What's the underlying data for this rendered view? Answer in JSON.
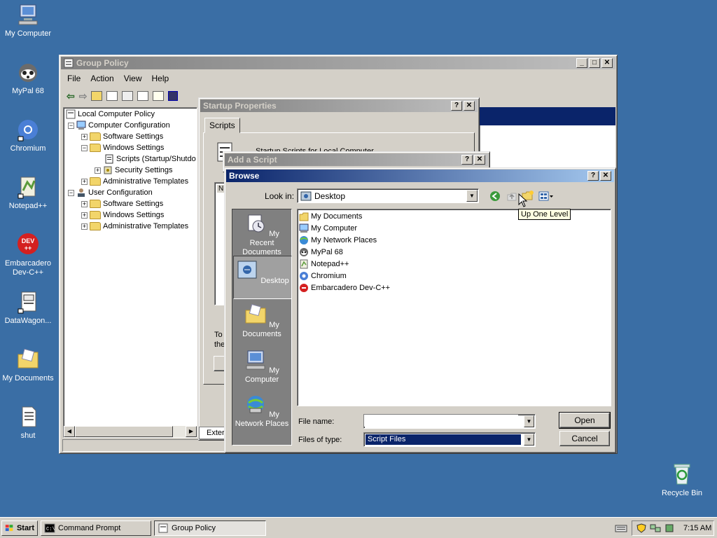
{
  "desktop": {
    "icons": [
      {
        "label": "My Computer"
      },
      {
        "label": "MyPal 68"
      },
      {
        "label": "Chromium"
      },
      {
        "label": "Notepad++"
      },
      {
        "label": "Embarcadero Dev-C++"
      },
      {
        "label": "DataWagon..."
      },
      {
        "label": "My Documents"
      },
      {
        "label": "shut"
      },
      {
        "label": "Recycle Bin"
      }
    ]
  },
  "group_policy": {
    "title": "Group Policy",
    "menu": [
      "File",
      "Action",
      "View",
      "Help"
    ],
    "tree": [
      {
        "label": "Local Computer Policy",
        "sign": ""
      },
      {
        "label": "Computer Configuration",
        "sign": "−"
      },
      {
        "label": "Software Settings",
        "sign": "+"
      },
      {
        "label": "Windows Settings",
        "sign": "−"
      },
      {
        "label": "Scripts (Startup/Shutdo",
        "sign": ""
      },
      {
        "label": "Security Settings",
        "sign": "+"
      },
      {
        "label": "Administrative Templates",
        "sign": "+"
      },
      {
        "label": "User Configuration",
        "sign": "−"
      },
      {
        "label": "Software Settings",
        "sign": "+"
      },
      {
        "label": "Windows Settings",
        "sign": "+"
      },
      {
        "label": "Administrative Templates",
        "sign": "+"
      }
    ],
    "extended_tab": "Exter"
  },
  "startup_properties": {
    "title": "Startup Properties",
    "tab": "Scripts",
    "heading": "Startup Scripts for Local Computer",
    "col_header": "N",
    "hint1": "To",
    "hint2": "the"
  },
  "add_script": {
    "title": "Add a Script"
  },
  "browse": {
    "title": "Browse",
    "look_in_label": "Look in:",
    "look_in_value": "Desktop",
    "tooltip": "Up One Level",
    "places": [
      {
        "label": "My Recent Documents"
      },
      {
        "label": "Desktop"
      },
      {
        "label": "My Documents"
      },
      {
        "label": "My Computer"
      },
      {
        "label": "My Network Places"
      }
    ],
    "files": [
      {
        "label": "My Documents"
      },
      {
        "label": "My Computer"
      },
      {
        "label": "My Network Places"
      },
      {
        "label": "MyPal 68"
      },
      {
        "label": "Notepad++"
      },
      {
        "label": "Chromium"
      },
      {
        "label": "Embarcadero Dev-C++"
      }
    ],
    "file_name_label": "File name:",
    "file_name_value": "",
    "files_of_type_label": "Files of type:",
    "files_of_type_value": "Script Files",
    "open_label": "Open",
    "cancel_label": "Cancel"
  },
  "taskbar": {
    "start_label": "Start",
    "buttons": [
      {
        "label": "Command Prompt"
      },
      {
        "label": "Group Policy"
      }
    ],
    "clock": "7:15 AM"
  }
}
